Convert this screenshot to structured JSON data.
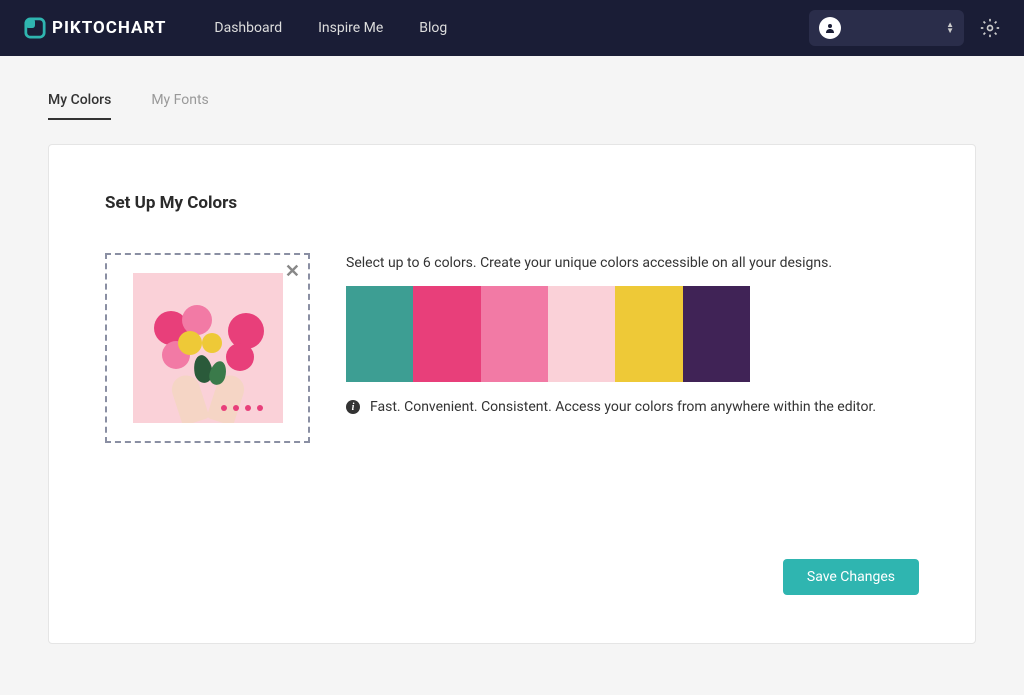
{
  "brand": "PIKTOCHART",
  "nav": {
    "dashboard": "Dashboard",
    "inspire": "Inspire Me",
    "blog": "Blog"
  },
  "tabs": {
    "colors": "My Colors",
    "fonts": "My Fonts"
  },
  "card": {
    "title": "Set Up My Colors",
    "description": "Select up to 6 colors. Create your unique colors accessible on all your designs.",
    "info": "Fast. Convenient. Consistent. Access your colors from anywhere within the editor.",
    "save": "Save Changes"
  },
  "palette": [
    "#3d9e93",
    "#e83f7a",
    "#f27aa5",
    "#fad1d8",
    "#eec937",
    "#402356"
  ],
  "accent": "#2fb5b0"
}
